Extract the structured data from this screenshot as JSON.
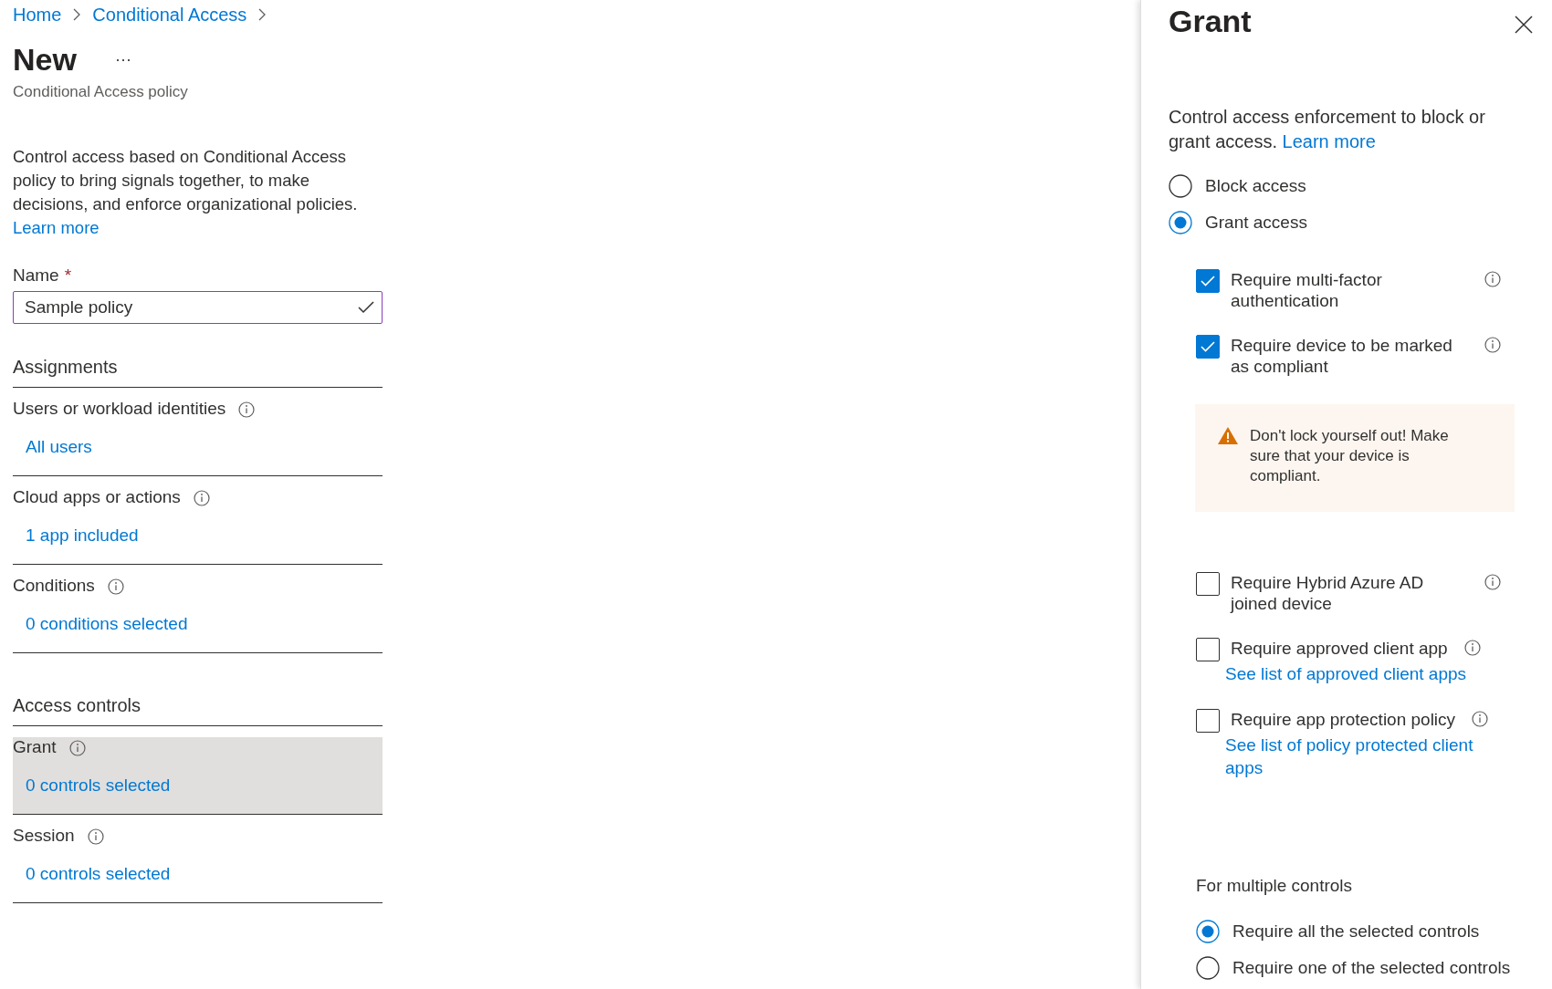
{
  "breadcrumb": [
    {
      "label": "Home"
    },
    {
      "label": "Conditional Access"
    }
  ],
  "header": {
    "title": "New",
    "more": "···",
    "subtitle": "Conditional Access policy"
  },
  "description": "Control access based on Conditional Access policy to bring signals together, to make decisions, and enforce organizational policies.",
  "learn_more": "Learn more",
  "name_field": {
    "label": "Name",
    "required_mark": "*",
    "value": "Sample policy",
    "valid": true
  },
  "sections": [
    {
      "heading": "Assignments",
      "items": [
        {
          "label": "Users or workload identities",
          "value": "All users",
          "selected": false
        },
        {
          "label": "Cloud apps or actions",
          "value": "1 app included",
          "selected": false
        },
        {
          "label": "Conditions",
          "value": "0 conditions selected",
          "selected": false
        }
      ]
    },
    {
      "heading": "Access controls",
      "items": [
        {
          "label": "Grant",
          "value": "0 controls selected",
          "selected": true
        },
        {
          "label": "Session",
          "value": "0 controls selected",
          "selected": false
        }
      ]
    }
  ],
  "panel": {
    "title": "Grant",
    "description": "Control access enforcement to block or grant access.",
    "learn_more": "Learn more",
    "access_options": [
      {
        "label": "Block access",
        "selected": false
      },
      {
        "label": "Grant access",
        "selected": true
      }
    ],
    "controls": [
      {
        "label": "Require multi-factor authentication",
        "checked": true
      },
      {
        "label": "Require device to be marked as compliant",
        "checked": true,
        "warning": "Don't lock yourself out! Make sure that your device is compliant."
      },
      {
        "label": "Require Hybrid Azure AD joined device",
        "checked": false
      },
      {
        "label": "Require approved client app",
        "checked": false,
        "link": "See list of approved client apps"
      },
      {
        "label": "Require app protection policy",
        "checked": false,
        "link": "See list of policy protected client apps"
      }
    ],
    "multiple": {
      "heading": "For multiple controls",
      "options": [
        {
          "label": "Require all the selected controls",
          "selected": true
        },
        {
          "label": "Require one of the selected controls",
          "selected": false
        }
      ]
    }
  }
}
